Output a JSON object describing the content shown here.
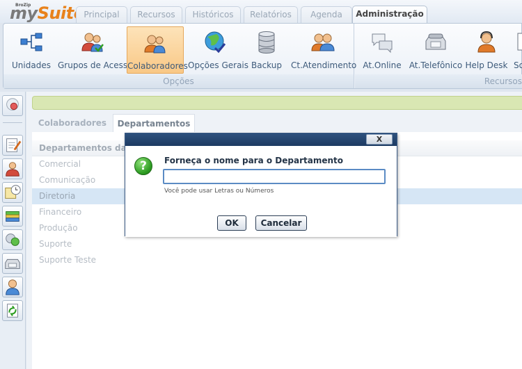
{
  "app": {
    "logo_small": "BroZip",
    "logo_my": "my",
    "logo_suite": "Suite"
  },
  "tabs": [
    {
      "label": "Principal"
    },
    {
      "label": "Recursos"
    },
    {
      "label": "Históricos"
    },
    {
      "label": "Relatórios"
    },
    {
      "label": "Agenda"
    },
    {
      "label": "Administração",
      "active": true
    }
  ],
  "ribbon": {
    "group_opcoes": "Opções",
    "group_recursos": "Recursos",
    "buttons": [
      {
        "label": "Unidades",
        "icon": "units-network-icon"
      },
      {
        "label": "Grupos de Acesso",
        "icon": "access-groups-icon"
      },
      {
        "label": "Colaboradores",
        "icon": "collaborators-icon",
        "selected": true
      },
      {
        "label": "Opções Gerais",
        "icon": "globe-check-icon"
      },
      {
        "label": "Backup",
        "icon": "database-icon"
      },
      {
        "label": "Ct.Atendimento",
        "icon": "service-center-icon"
      }
    ],
    "recursos_buttons": [
      {
        "label": "At.Online",
        "icon": "chat-bubbles-icon"
      },
      {
        "label": "At.Telefônico",
        "icon": "telephone-icon"
      },
      {
        "label": "Help Desk",
        "icon": "helpdesk-headset-icon"
      },
      {
        "label": "Soli",
        "icon": "document-icon"
      }
    ]
  },
  "subtabs": [
    {
      "label": "Colaboradores"
    },
    {
      "label": "Departamentos",
      "active": true
    }
  ],
  "grid": {
    "header": "Departamentos da Em",
    "rows": [
      "Comercial",
      "Comunicação",
      "Diretoria",
      "Financeiro",
      "Produção",
      "Suporte",
      "Suporte Teste"
    ],
    "selected_row": "Diretoria"
  },
  "dialog": {
    "close_label": "X",
    "prompt": "Forneça o nome para o Departamento",
    "input_value": "",
    "hint": "Você pode usar Letras ou Números",
    "ok_label": "OK",
    "cancel_label": "Cancelar"
  },
  "colors": {
    "accent_orange": "#e8821c",
    "title_bar": "#1c3a62",
    "selection": "#d6e6f5",
    "notice": "#d9e7b3"
  }
}
